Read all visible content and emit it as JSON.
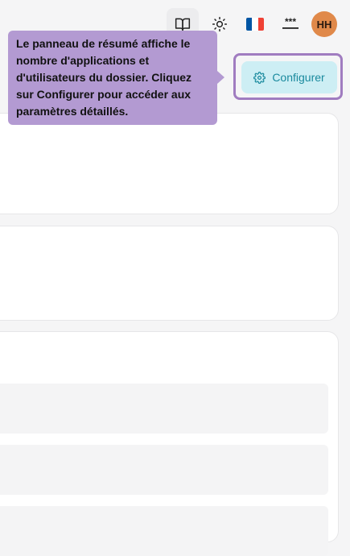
{
  "topbar": {
    "docs_icon": "book-open-icon",
    "theme_icon": "sun-icon",
    "language": {
      "icon": "france-flag-icon",
      "colors": [
        "#0055a4",
        "#ffffff",
        "#ef4135"
      ]
    },
    "password_icon": "password-dots-icon",
    "avatar_initials": "HH",
    "avatar_color": "#e0894a"
  },
  "summary": {
    "configure_label": "Configurer",
    "configure_icon": "gear-icon"
  },
  "tour": {
    "tooltip_text": "Le panneau de résumé affiche le nombre d'applications et d'utilisateurs du dossier. Cliquez sur Configurer pour accéder aux paramètres détaillés.",
    "highlight_color": "#a07cc0",
    "tooltip_color": "#b39ad2"
  },
  "colors": {
    "accent": "#1a8a9e",
    "accent_bg": "#cdeef4"
  }
}
